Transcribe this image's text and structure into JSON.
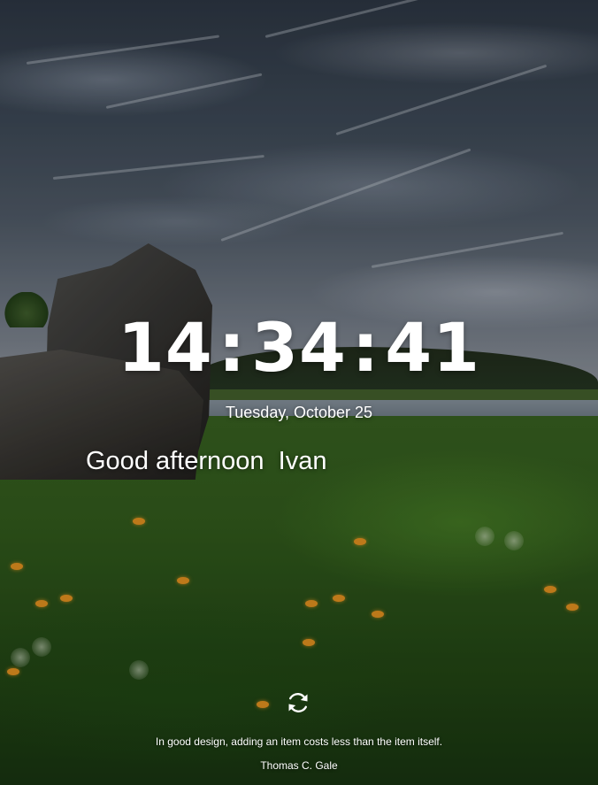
{
  "clock": {
    "hours": "14",
    "minutes": "34",
    "seconds": "41",
    "separator": ":"
  },
  "date": "Tuesday, October 25",
  "greeting": {
    "salutation": "Good afternoon",
    "name": "Ivan"
  },
  "refresh": {
    "icon": "refresh-icon"
  },
  "quote": {
    "text": "In good design, adding an item costs less than the item itself.",
    "author": "Thomas C. Gale"
  },
  "colors": {
    "text": "#ffffff",
    "accent_flower": "#d88a1e"
  }
}
